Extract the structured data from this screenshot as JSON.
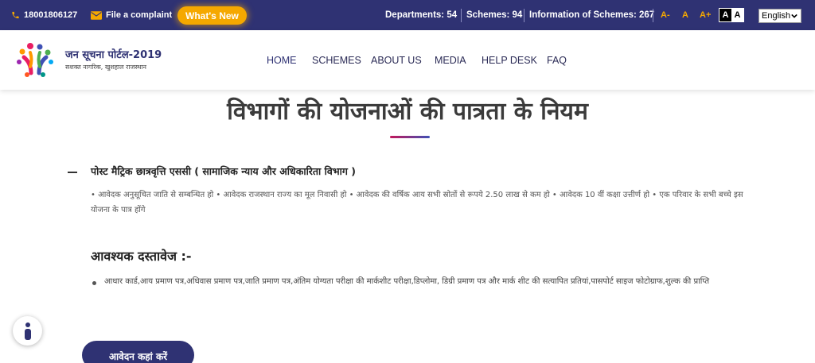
{
  "topbar": {
    "phone": "18001806127",
    "complaint": "File a complaint",
    "whats_new": "What's New",
    "departments": "Departments: 54",
    "schemes": "Schemes: 94",
    "info_schemes": "Information of Schemes: 267",
    "font_small": "A-",
    "font_normal": "A",
    "font_large": "A+",
    "contrast_dark": "A",
    "contrast_light": "A",
    "language": "English"
  },
  "header": {
    "logo_title": "जन सूचना पोर्टल-2019",
    "logo_subtitle": "सशक्त नागरिक, खुशहाल राजस्थान",
    "nav": [
      "HOME",
      "SCHEMES",
      "ABOUT US",
      "MEDIA",
      "HELP DESK",
      "FAQ"
    ]
  },
  "main": {
    "title": "विभागों की योजनाओं की पात्रता के नियम",
    "scheme_title": "पोस्ट मैट्रिक छात्रवृत्ति एससी  ( सामाजिक न्याय और अधिकारिता विभाग )",
    "eligibility": "• आवेदक अनुसूचित जाति से सम्बन्धित हो • आवेदक राजस्थान राज्य का मूल निवासी हो • आवेदक की वर्षिक आय सभी स्रोतों से रूपये 2.50 लाख से कम हो • आवेदक 10 वीं कक्षा उत्तीर्ण हो • एक परिवार के सभी बच्चे इस योजना के पात्र होंगे",
    "documents_heading": "आवश्यक दस्तावेज :-",
    "documents": "आधार कार्ड,आय प्रमाण पत्र,अधिवास प्रमाण पत्र,जाति प्रमाण पत्र,अंतिम योग्यता परीक्षा की मार्कशीट परीक्षा,डिप्लोमा, डिग्री प्रमाण पत्र और मार्क शीट की सत्यापित प्रतियां,पासपोर्ट साइज फोटोग्राफ,शुल्क की प्राप्ति",
    "apply_button": "आवेदन कहां करें"
  },
  "colors": {
    "primary": "#2f3273",
    "accent": "#f5a800"
  },
  "icons": [
    "phone-icon",
    "mail-icon",
    "info-icon",
    "chevron-down-icon",
    "portal-logo"
  ]
}
